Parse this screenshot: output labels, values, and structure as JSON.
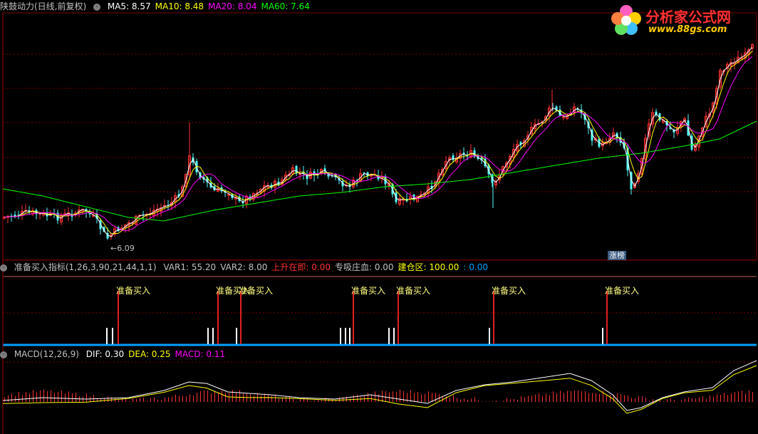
{
  "main_header": {
    "title": "陕鼓动力(日线,前复权)",
    "ma": [
      {
        "label": "MA5: 8.57",
        "color": "#ffffff"
      },
      {
        "label": "MA10: 8.48",
        "color": "#ffff00"
      },
      {
        "label": "MA20: 8.04",
        "color": "#ff00ff"
      },
      {
        "label": "MA60: 7.64",
        "color": "#00ff00"
      }
    ]
  },
  "logo": {
    "name": "分析家公式网",
    "url": "www.88gs.com"
  },
  "price_chart": {
    "min_label": "←6.09",
    "badge": "涨榜",
    "colors": {
      "up": "#ff3232",
      "down": "#54ffff",
      "grid": "#7a0000",
      "ma5": "#ffffff",
      "ma10": "#ffff00",
      "ma20": "#ff00ff",
      "ma60": "#00ff00"
    }
  },
  "indicator_header": {
    "name": "准备买入指标(1,26,3,90,21,44,1,1)",
    "items": [
      {
        "label": "VAR1: 55.20",
        "color": "#c0c0c0"
      },
      {
        "label": "VAR2: 8.00",
        "color": "#c0c0c0"
      },
      {
        "label": "上升在即: 0.00",
        "color": "#ff3232"
      },
      {
        "label": "专吸庄血: 0.00",
        "color": "#c0c0c0"
      },
      {
        "label": "建仓区: 100.00",
        "color": "#ffff00"
      },
      {
        "label": ": 0.00",
        "color": "#00a0ff"
      }
    ]
  },
  "signals": {
    "label": "准备买入",
    "buy_positions": [
      165,
      305,
      337,
      495,
      558,
      692,
      851
    ],
    "white_bars": [
      149,
      157,
      291,
      298,
      331,
      477,
      484,
      490,
      545,
      552,
      686,
      845
    ]
  },
  "macd_header": {
    "name": "MACD(12,26,9)",
    "items": [
      {
        "label": "DIF: 0.30",
        "color": "#ffffff"
      },
      {
        "label": "DEA: 0.25",
        "color": "#ffff00"
      },
      {
        "label": "MACD: 0.11",
        "color": "#ff00ff"
      }
    ]
  },
  "chart_data": {
    "type": "candlestick",
    "series_hint": "daily stock price with moving averages",
    "ma_values": {
      "MA5": 8.57,
      "MA10": 8.48,
      "MA20": 8.04,
      "MA60": 7.64
    },
    "min_price": 6.09
  }
}
